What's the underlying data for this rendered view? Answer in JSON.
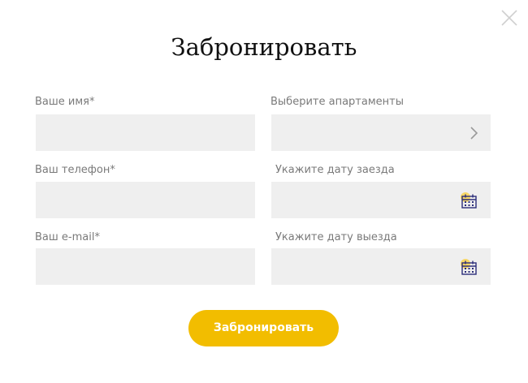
{
  "modal": {
    "title": "Забронировать",
    "close_icon": "close-icon"
  },
  "form": {
    "name": {
      "label": "Ваше имя*",
      "value": "",
      "placeholder": ""
    },
    "phone": {
      "label": "Ваш телефон*",
      "value": "",
      "placeholder": ""
    },
    "email": {
      "label": "Ваш e-mail*",
      "value": "",
      "placeholder": ""
    },
    "apartments": {
      "label": "Выберите апартаменты",
      "selected": "",
      "icon": "chevron-right-icon"
    },
    "checkin": {
      "label": "Укажите дату заезда",
      "value": "",
      "icon": "calendar-icon"
    },
    "checkout": {
      "label": "Укажите дату выезда",
      "value": "",
      "icon": "calendar-icon"
    },
    "submit_label": "Забронировать"
  },
  "colors": {
    "accent": "#f2bd00",
    "field_bg": "#efefef",
    "label": "#7a7a7a",
    "calendar_frame": "#2b2d7a",
    "calendar_highlight": "#f7d766"
  }
}
